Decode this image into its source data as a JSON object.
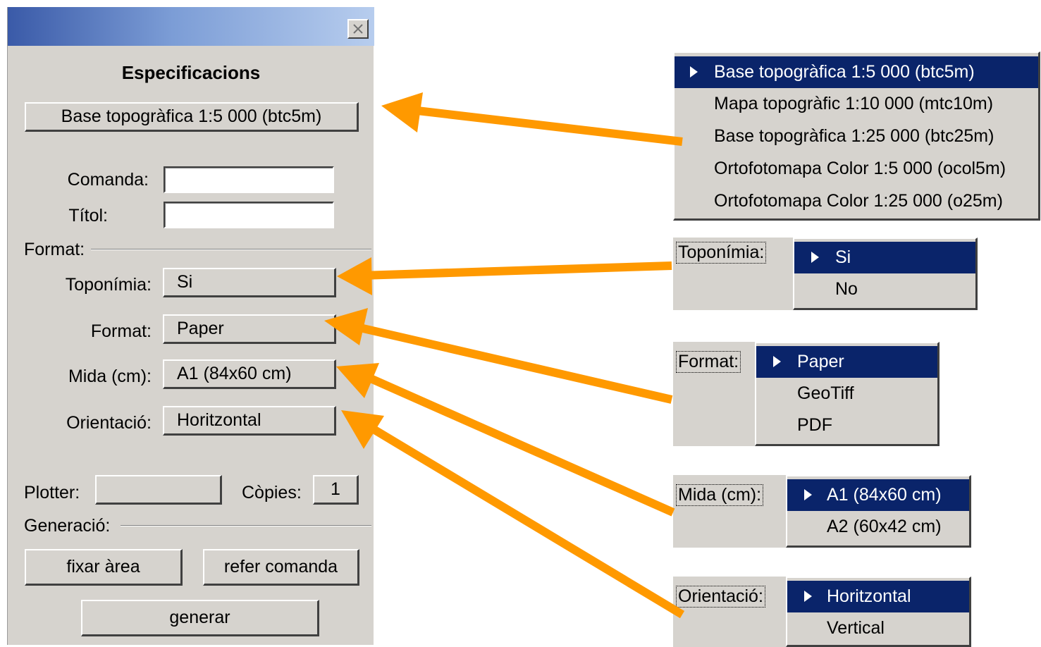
{
  "dialog": {
    "title": "Especificacions",
    "product_button": "Base topogràfica 1:5 000 (btc5m)",
    "comanda_label": "Comanda:",
    "comanda_value": "",
    "titol_label": "Títol:",
    "titol_value": "",
    "format_section": "Format:",
    "toponimia_label": "Toponímia:",
    "toponimia_value": "Si",
    "format_label": "Format:",
    "format_value": "Paper",
    "mida_label": "Mida (cm):",
    "mida_value": "A1 (84x60 cm)",
    "orientacio_label": "Orientació:",
    "orientacio_value": "Horitzontal",
    "plotter_label": "Plotter:",
    "plotter_value": "",
    "copies_label": "Còpies:",
    "copies_value": "1",
    "generacio_section": "Generació:",
    "fixar_area": "fixar àrea",
    "refer_comanda": "refer comanda",
    "generar": "generar"
  },
  "menus": {
    "product": {
      "items": [
        "Base topogràfica 1:5 000 (btc5m)",
        "Mapa topogràfic 1:10 000 (mtc10m)",
        "Base topogràfica 1:25 000 (btc25m)",
        "Ortofotomapa Color 1:5 000 (ocol5m)",
        "Ortofotomapa Color 1:25 000 (o25m)"
      ],
      "selected": 0
    },
    "toponimia": {
      "label": "Toponímia:",
      "items": [
        "Si",
        "No"
      ],
      "selected": 0
    },
    "format": {
      "label": "Format:",
      "items": [
        "Paper",
        "GeoTiff",
        "PDF"
      ],
      "selected": 0
    },
    "mida": {
      "label": "Mida (cm):",
      "items": [
        "A1 (84x60 cm)",
        "A2 (60x42 cm)"
      ],
      "selected": 0
    },
    "orientacio": {
      "label": "Orientació:",
      "items": [
        "Horitzontal",
        "Vertical"
      ],
      "selected": 0
    }
  },
  "colors": {
    "arrow": "#ff9900",
    "menu_selected": "#0a246a",
    "face": "#d6d3ce"
  }
}
